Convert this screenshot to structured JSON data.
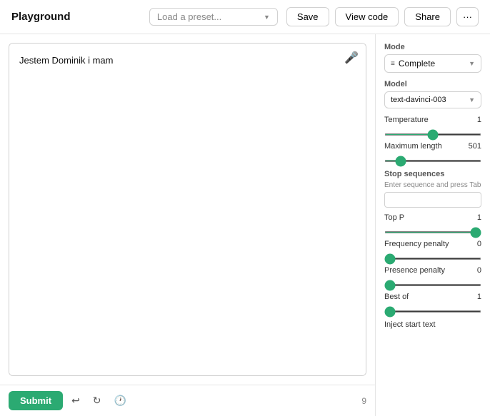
{
  "header": {
    "title": "Playground",
    "preset_placeholder": "Load a preset...",
    "save_label": "Save",
    "view_code_label": "View code",
    "share_label": "Share",
    "more_label": "···"
  },
  "editor": {
    "content": "Jestem Dominik i mam",
    "mic_icon": "🎤",
    "counter": "9"
  },
  "footer": {
    "submit_label": "Submit",
    "undo_icon": "↩",
    "redo_icon": "↻",
    "history_icon": "🕐"
  },
  "sidebar": {
    "mode_label": "Mode",
    "mode_value": "Complete",
    "mode_icon": "≡",
    "model_label": "Model",
    "model_value": "text-davinci-003",
    "temperature_label": "Temperature",
    "temperature_value": "1",
    "temperature_min": 0,
    "temperature_max": 2,
    "temperature_current": 1,
    "max_length_label": "Maximum length",
    "max_length_value": "501",
    "max_length_min": 0,
    "max_length_max": 4096,
    "max_length_current": 501,
    "stop_sequences_label": "Stop sequences",
    "stop_sequences_hint": "Enter sequence and press Tab",
    "stop_sequences_value": "",
    "top_p_label": "Top P",
    "top_p_value": "1",
    "top_p_min": 0,
    "top_p_max": 1,
    "top_p_current": 1,
    "freq_penalty_label": "Frequency penalty",
    "freq_penalty_value": "0",
    "freq_penalty_min": 0,
    "freq_penalty_max": 2,
    "freq_penalty_current": 0,
    "presence_penalty_label": "Presence penalty",
    "presence_penalty_value": "0",
    "presence_penalty_min": 0,
    "presence_penalty_max": 2,
    "presence_penalty_current": 0,
    "best_of_label": "Best of",
    "best_of_value": "1",
    "best_of_min": 1,
    "best_of_max": 20,
    "best_of_current": 1,
    "inject_label": "Inject start text"
  }
}
